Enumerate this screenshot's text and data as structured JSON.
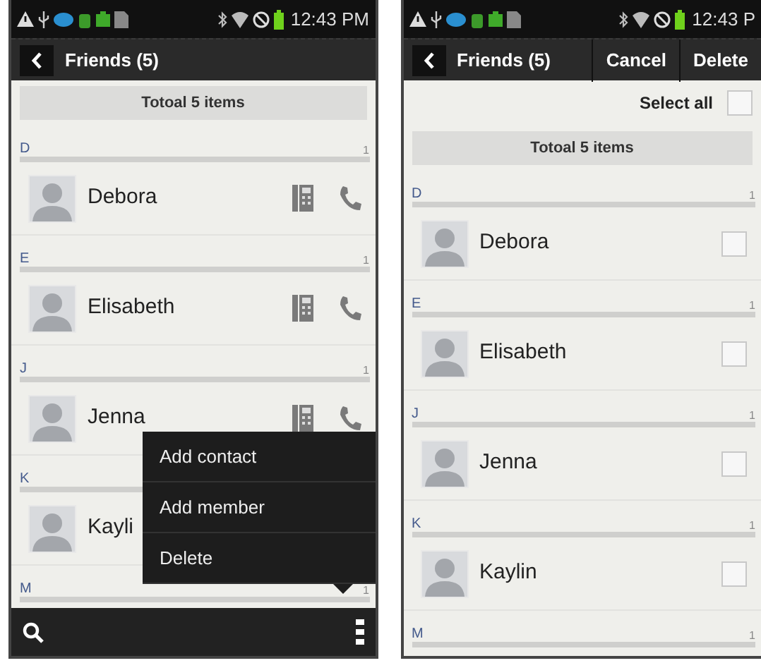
{
  "phones": [
    {
      "kind": "browse",
      "status_bar": {
        "time": "12:43 PM"
      },
      "title_bar": {
        "title": "Friends (5)"
      },
      "total_banner": "Totoal 5 items",
      "sections": [
        {
          "letter": "D",
          "count": "1",
          "contacts": [
            {
              "name": "Debora"
            }
          ]
        },
        {
          "letter": "E",
          "count": "1",
          "contacts": [
            {
              "name": "Elisabeth"
            }
          ]
        },
        {
          "letter": "J",
          "count": "1",
          "contacts": [
            {
              "name": "Jenna"
            }
          ]
        },
        {
          "letter": "K",
          "contacts": [
            {
              "name": "Kayli"
            }
          ]
        },
        {
          "letter": "M",
          "count": "1"
        }
      ],
      "popup_menu": [
        "Add contact",
        "Add member",
        "Delete"
      ]
    },
    {
      "kind": "edit",
      "status_bar": {
        "time": "12:43 P"
      },
      "title_bar": {
        "title": "Friends (5)",
        "actions": [
          "Cancel",
          "Delete"
        ]
      },
      "select_all": {
        "label": "Select all",
        "checked": false
      },
      "total_banner": "Totoal 5 items",
      "sections": [
        {
          "letter": "D",
          "count": "1",
          "contacts": [
            {
              "name": "Debora",
              "checked": false
            }
          ]
        },
        {
          "letter": "E",
          "count": "1",
          "contacts": [
            {
              "name": "Elisabeth",
              "checked": false
            }
          ]
        },
        {
          "letter": "J",
          "count": "1",
          "contacts": [
            {
              "name": "Jenna",
              "checked": false
            }
          ]
        },
        {
          "letter": "K",
          "count": "1",
          "contacts": [
            {
              "name": "Kaylin",
              "checked": false
            }
          ]
        },
        {
          "letter": "M",
          "count": "1"
        }
      ]
    }
  ]
}
